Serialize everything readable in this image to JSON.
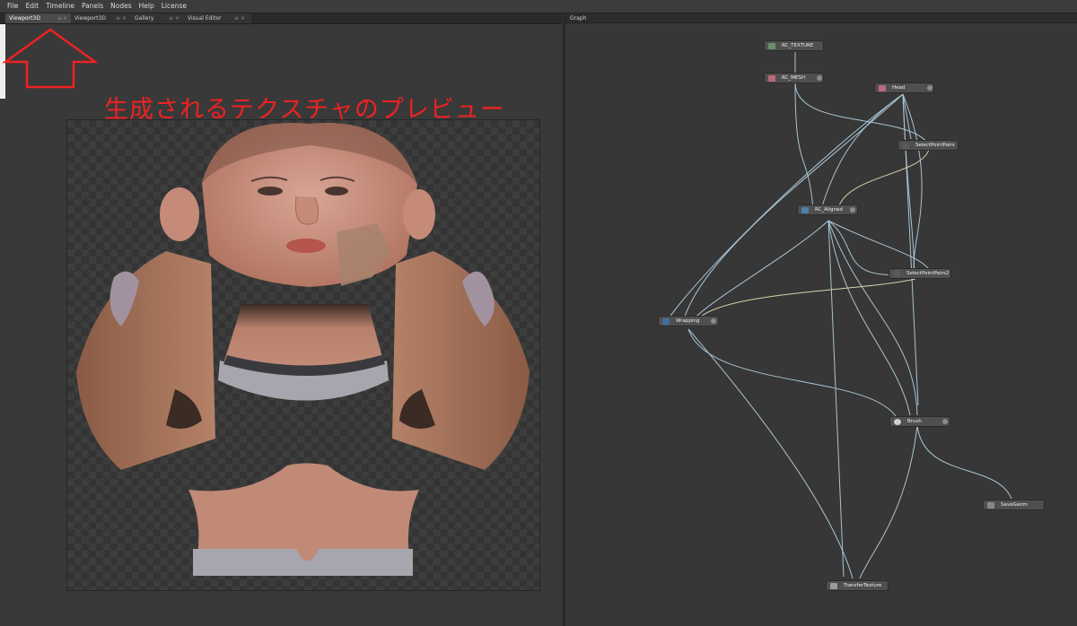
{
  "menu": [
    "File",
    "Edit",
    "Timeline",
    "Panels",
    "Nodes",
    "Help",
    "License"
  ],
  "viewport_tabs": [
    {
      "label": "Viewport3D",
      "active": true
    },
    {
      "label": "Viewport3D",
      "active": false
    },
    {
      "label": "Gallery",
      "active": false
    },
    {
      "label": "Visual Editor",
      "active": false
    }
  ],
  "tab_controls": {
    "menu": "≡",
    "close": "×"
  },
  "annotation": {
    "text": "生成されるテクスチャのプレビュー",
    "color": "#ee2222"
  },
  "graph": {
    "title": "Graph",
    "nodes": {
      "rc_texture": "RC_TEXTURE",
      "rc_mesh": "RC_MESH",
      "head": "Head",
      "select_point_pairs": "SelectPointPairs",
      "rc_aligned": "RC_Aligned",
      "select_point_pairs2": "SelectPointPairs2",
      "wrapping": "Wrapping",
      "brush": "Brush",
      "save_geom": "SaveGeom",
      "transfer_texture": "TransferTexture"
    },
    "wire_color": "#a9c4d4",
    "highlight_wire_color": "#d8d2a8"
  },
  "colors": {
    "skin": "#c48a76",
    "shirt": "#a6a6ae",
    "background": "#393939"
  }
}
